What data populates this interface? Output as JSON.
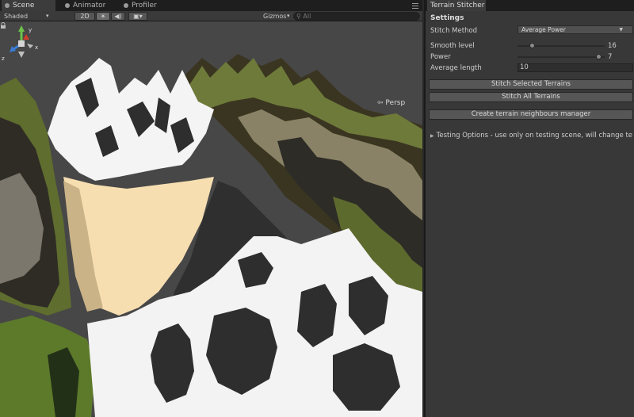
{
  "scene_tabs": {
    "scene": "Scene",
    "animator": "Animator",
    "profiler": "Profiler"
  },
  "scene_toolbar": {
    "shading_mode": "Shaded",
    "mode_2d": "2D",
    "gizmos": "Gizmos",
    "search_placeholder": "All"
  },
  "viewport": {
    "projection_label": "Persp",
    "gizmo_axes": {
      "x": "x",
      "y": "y",
      "z": "z"
    }
  },
  "inspector": {
    "tab_title": "Terrain Stitcher",
    "settings_title": "Settings",
    "stitch_method_label": "Stitch Method",
    "stitch_method_value": "Average Power",
    "smooth_level_label": "Smooth level",
    "smooth_level_value": "16",
    "smooth_level_fraction": 0.15,
    "power_label": "Power",
    "power_value": "7",
    "power_fraction": 0.96,
    "average_length_label": "Average length",
    "average_length_value": "10",
    "stitch_selected_label": "Stitch Selected Terrains",
    "stitch_all_label": "Stitch All Terrains",
    "create_manager_label": "Create terrain neighbours manager",
    "testing_options_label": "Testing Options - use only on testing scene, will change te"
  },
  "colors": {
    "panel_bg": "#383838",
    "viewport_bg": "#474747",
    "button_bg": "#565656",
    "gizmo_x": "#d23c2c",
    "gizmo_y": "#6cc24a",
    "gizmo_z": "#3a7bd5"
  }
}
